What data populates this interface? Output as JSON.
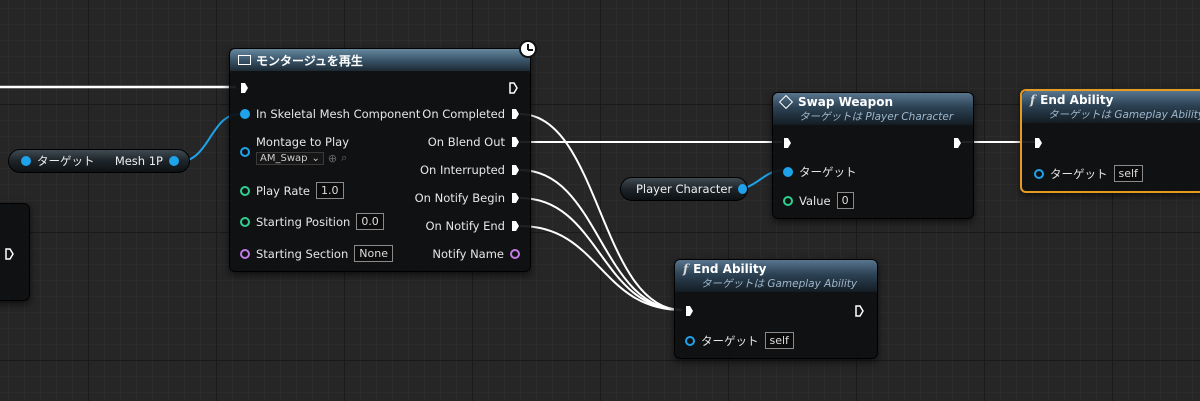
{
  "montage_node": {
    "title": "モンタージュを再生",
    "inputs": {
      "skeletal_mesh": "In Skeletal Mesh Component",
      "montage_to_play": "Montage to Play",
      "montage_value": "AM_Swap",
      "play_rate": "Play Rate",
      "play_rate_value": "1.0",
      "starting_position": "Starting Position",
      "starting_position_value": "0.0",
      "starting_section": "Starting Section",
      "starting_section_value": "None"
    },
    "outputs": {
      "on_completed": "On Completed",
      "on_blend_out": "On Blend Out",
      "on_interrupted": "On Interrupted",
      "on_notify_begin": "On Notify Begin",
      "on_notify_end": "On Notify End",
      "notify_name": "Notify Name"
    }
  },
  "target_var_node": {
    "target": "ターゲット",
    "mesh": "Mesh 1P"
  },
  "swap_node": {
    "title": "Swap Weapon",
    "subtitle": "ターゲットは Player Character",
    "target": "ターゲット",
    "value_label": "Value",
    "value": "0"
  },
  "player_character_node": {
    "label": "Player Character"
  },
  "end_ability_top": {
    "title": "End Ability",
    "subtitle": "ターゲットは Gameplay Ability",
    "target": "ターゲット",
    "target_value": "self"
  },
  "end_ability_bottom": {
    "title": "End Ability",
    "subtitle": "ターゲットは Gameplay Ability",
    "target": "ターゲット",
    "target_value": "self"
  },
  "icons": {
    "function": "f",
    "exec_pin": "exec-arrow",
    "clock": "latent-clock"
  },
  "colors": {
    "exec_wire": "#ffffff",
    "object_pin": "#1ea2ea",
    "int_pin": "#2fd08f",
    "name_pin": "#c37be6",
    "selected_border": "#e59b1f"
  }
}
